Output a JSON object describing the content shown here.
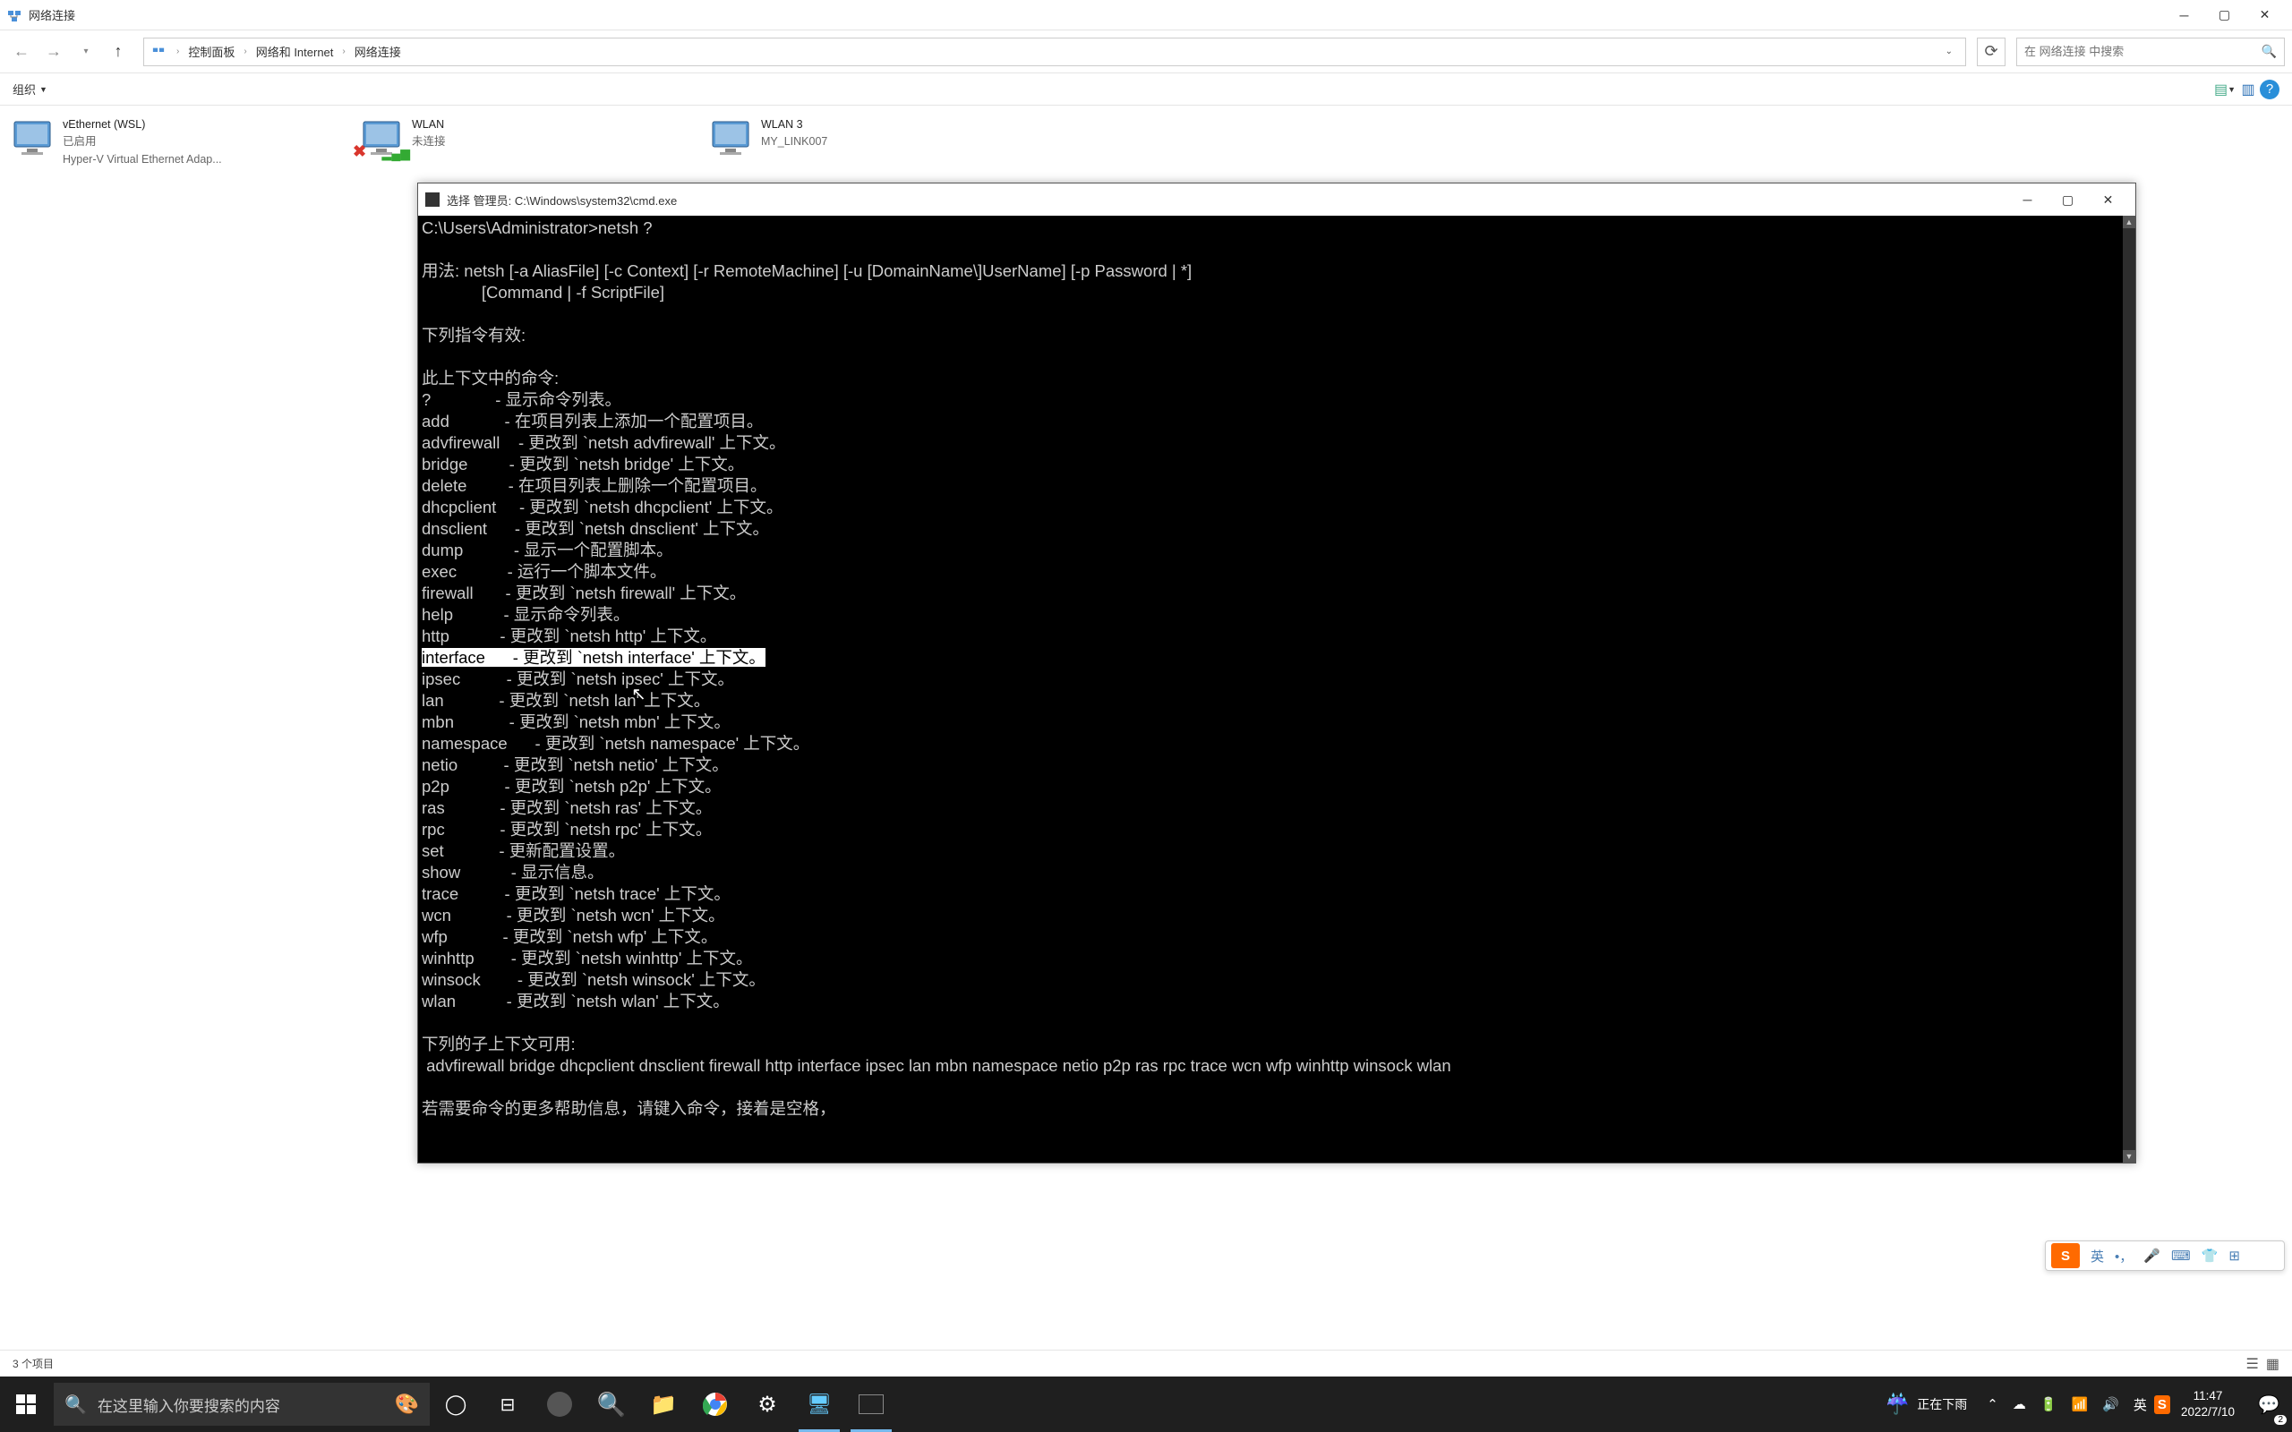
{
  "explorer": {
    "title": "网络连接",
    "breadcrumb": [
      "控制面板",
      "网络和 Internet",
      "网络连接"
    ],
    "search_placeholder": "在 网络连接 中搜索",
    "toolbar_organize": "组织",
    "items": [
      {
        "name": "vEthernet (WSL)",
        "status": "已启用",
        "desc": "Hyper-V Virtual Ethernet Adap..."
      },
      {
        "name": "WLAN",
        "status": "未连接",
        "desc": ""
      },
      {
        "name": "WLAN 3",
        "status": "MY_LINK007",
        "desc": ""
      }
    ],
    "status_text": "3 个项目"
  },
  "cmd": {
    "title": "选择 管理员: C:\\Windows\\system32\\cmd.exe",
    "lines": [
      "C:\\Users\\Administrator>netsh ?",
      "",
      "用法: netsh [-a AliasFile] [-c Context] [-r RemoteMachine] [-u [DomainName\\]UserName] [-p Password | *]",
      "             [Command | -f ScriptFile]",
      "",
      "下列指令有效:",
      "",
      "此上下文中的命令:",
      "?              - 显示命令列表。",
      "add            - 在项目列表上添加一个配置项目。",
      "advfirewall    - 更改到 `netsh advfirewall' 上下文。",
      "bridge         - 更改到 `netsh bridge' 上下文。",
      "delete         - 在项目列表上删除一个配置项目。",
      "dhcpclient     - 更改到 `netsh dhcpclient' 上下文。",
      "dnsclient      - 更改到 `netsh dnsclient' 上下文。",
      "dump           - 显示一个配置脚本。",
      "exec           - 运行一个脚本文件。",
      "firewall       - 更改到 `netsh firewall' 上下文。",
      "help           - 显示命令列表。",
      "http           - 更改到 `netsh http' 上下文。",
      "interface      - 更改到 `netsh interface' 上下文。",
      "ipsec          - 更改到 `netsh ipsec' 上下文。",
      "lan            - 更改到 `netsh lan' 上下文。",
      "mbn            - 更改到 `netsh mbn' 上下文。",
      "namespace      - 更改到 `netsh namespace' 上下文。",
      "netio          - 更改到 `netsh netio' 上下文。",
      "p2p            - 更改到 `netsh p2p' 上下文。",
      "ras            - 更改到 `netsh ras' 上下文。",
      "rpc            - 更改到 `netsh rpc' 上下文。",
      "set            - 更新配置设置。",
      "show           - 显示信息。",
      "trace          - 更改到 `netsh trace' 上下文。",
      "wcn            - 更改到 `netsh wcn' 上下文。",
      "wfp            - 更改到 `netsh wfp' 上下文。",
      "winhttp        - 更改到 `netsh winhttp' 上下文。",
      "winsock        - 更改到 `netsh winsock' 上下文。",
      "wlan           - 更改到 `netsh wlan' 上下文。",
      "",
      "下列的子上下文可用:",
      " advfirewall bridge dhcpclient dnsclient firewall http interface ipsec lan mbn namespace netio p2p ras rpc trace wcn wfp winhttp winsock wlan",
      "",
      "若需要命令的更多帮助信息，请键入命令，接着是空格，"
    ],
    "selected_index": 20
  },
  "taskbar": {
    "search_placeholder": "在这里输入你要搜索的内容",
    "weather": "正在下雨",
    "ime": "英",
    "time": "11:47",
    "date": "2022/7/10",
    "notif_count": "2"
  },
  "ime": {
    "lang": "英"
  }
}
